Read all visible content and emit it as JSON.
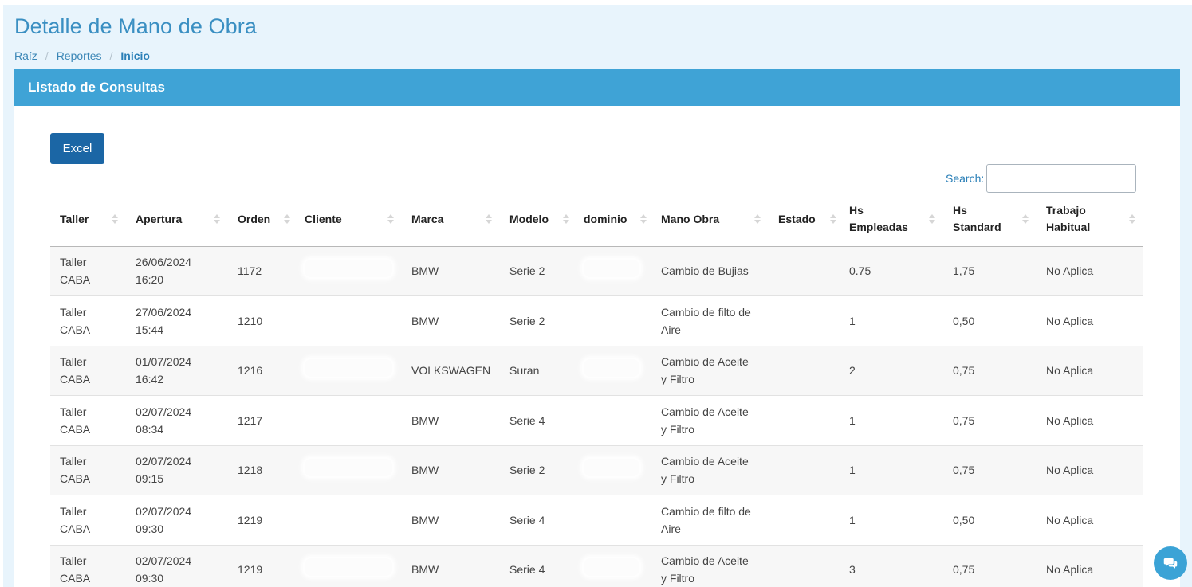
{
  "page": {
    "title": "Detalle de Mano de Obra",
    "breadcrumb": [
      "Raíz",
      "Reportes",
      "Inicio"
    ]
  },
  "panel": {
    "title": "Listado de Consultas",
    "excel_label": "Excel",
    "search_label": "Search:",
    "search_value": ""
  },
  "table": {
    "columns": [
      {
        "line1": "Taller",
        "line2": ""
      },
      {
        "line1": "Apertura",
        "line2": ""
      },
      {
        "line1": "Orden",
        "line2": ""
      },
      {
        "line1": "Cliente",
        "line2": ""
      },
      {
        "line1": "Marca",
        "line2": ""
      },
      {
        "line1": "Modelo",
        "line2": ""
      },
      {
        "line1": "dominio",
        "line2": ""
      },
      {
        "line1": "Mano Obra",
        "line2": ""
      },
      {
        "line1": "Estado",
        "line2": ""
      },
      {
        "line1": "Hs",
        "line2": "Empleadas"
      },
      {
        "line1": "Hs",
        "line2": "Standard"
      },
      {
        "line1": "Trabajo",
        "line2": "Habitual"
      }
    ],
    "rows": [
      {
        "taller": [
          "Taller",
          "CABA"
        ],
        "apertura": [
          "26/06/2024",
          "16:20"
        ],
        "orden": "1172",
        "cliente": "",
        "marca": "BMW",
        "modelo": "Serie 2",
        "dominio": "",
        "mano_obra": [
          "Cambio de Bujias",
          ""
        ],
        "estado": "",
        "hs_empleadas": "0.75",
        "hs_standard": "1,75",
        "trabajo_habitual": "No Aplica"
      },
      {
        "taller": [
          "Taller",
          "CABA"
        ],
        "apertura": [
          "27/06/2024",
          "15:44"
        ],
        "orden": "1210",
        "cliente": "",
        "marca": "BMW",
        "modelo": "Serie 2",
        "dominio": "",
        "mano_obra": [
          "Cambio de filto de",
          "Aire"
        ],
        "estado": "",
        "hs_empleadas": "1",
        "hs_standard": "0,50",
        "trabajo_habitual": "No Aplica"
      },
      {
        "taller": [
          "Taller",
          "CABA"
        ],
        "apertura": [
          "01/07/2024",
          "16:42"
        ],
        "orden": "1216",
        "cliente": "",
        "marca": "VOLKSWAGEN",
        "modelo": "Suran",
        "dominio": "",
        "mano_obra": [
          "Cambio de Aceite",
          "y Filtro"
        ],
        "estado": "",
        "hs_empleadas": "2",
        "hs_standard": "0,75",
        "trabajo_habitual": "No Aplica"
      },
      {
        "taller": [
          "Taller",
          "CABA"
        ],
        "apertura": [
          "02/07/2024",
          "08:34"
        ],
        "orden": "1217",
        "cliente": "",
        "marca": "BMW",
        "modelo": "Serie 4",
        "dominio": "",
        "mano_obra": [
          "Cambio de Aceite",
          "y Filtro"
        ],
        "estado": "",
        "hs_empleadas": "1",
        "hs_standard": "0,75",
        "trabajo_habitual": "No Aplica"
      },
      {
        "taller": [
          "Taller",
          "CABA"
        ],
        "apertura": [
          "02/07/2024",
          "09:15"
        ],
        "orden": "1218",
        "cliente": "",
        "marca": "BMW",
        "modelo": "Serie 2",
        "dominio": "",
        "mano_obra": [
          "Cambio de Aceite",
          "y Filtro"
        ],
        "estado": "",
        "hs_empleadas": "1",
        "hs_standard": "0,75",
        "trabajo_habitual": "No Aplica"
      },
      {
        "taller": [
          "Taller",
          "CABA"
        ],
        "apertura": [
          "02/07/2024",
          "09:30"
        ],
        "orden": "1219",
        "cliente": "",
        "marca": "BMW",
        "modelo": "Serie 4",
        "dominio": "",
        "mano_obra": [
          "Cambio de filto de",
          "Aire"
        ],
        "estado": "",
        "hs_empleadas": "1",
        "hs_standard": "0,50",
        "trabajo_habitual": "No Aplica"
      },
      {
        "taller": [
          "Taller",
          "CABA"
        ],
        "apertura": [
          "02/07/2024",
          "09:30"
        ],
        "orden": "1219",
        "cliente": "",
        "marca": "BMW",
        "modelo": "Serie 4",
        "dominio": "",
        "mano_obra": [
          "Cambio de Aceite",
          "y Filtro"
        ],
        "estado": "",
        "hs_empleadas": "3",
        "hs_standard": "0,75",
        "trabajo_habitual": "No Aplica"
      }
    ]
  },
  "icons": {
    "sort": "sort-icon",
    "chat": "chat-icon"
  },
  "colors": {
    "accent": "#3fa3d6",
    "button": "#1b66a5",
    "title": "#3a8fc2"
  }
}
